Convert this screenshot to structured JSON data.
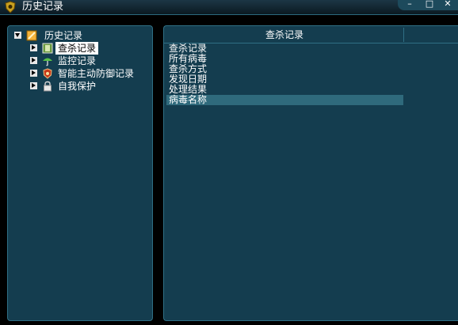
{
  "window": {
    "title": "历史记录",
    "controls": {
      "minimize": "–",
      "maximize": "□",
      "close": "✕"
    }
  },
  "tree": {
    "root": {
      "label": "历史记录",
      "icon": "history-book-icon",
      "expanded": true
    },
    "children": [
      {
        "label": "查杀记录",
        "icon": "scan-record-icon",
        "selected": true
      },
      {
        "label": "监控记录",
        "icon": "umbrella-monitor-icon",
        "selected": false
      },
      {
        "label": "智能主动防御记录",
        "icon": "shield-defense-icon",
        "selected": false
      },
      {
        "label": "自我保护",
        "icon": "padlock-icon",
        "selected": false
      }
    ]
  },
  "list": {
    "header": "查杀记录",
    "items": [
      "查杀记录",
      "所有病毒",
      "查杀方式",
      "发现日期",
      "处理结果",
      "病毒名称"
    ],
    "selected_index": 5
  },
  "colors": {
    "panel_bg": "#143d4f",
    "panel_border": "#2f6f85",
    "selection_bg": "#2f6a7c",
    "window_bg": "#000000"
  }
}
